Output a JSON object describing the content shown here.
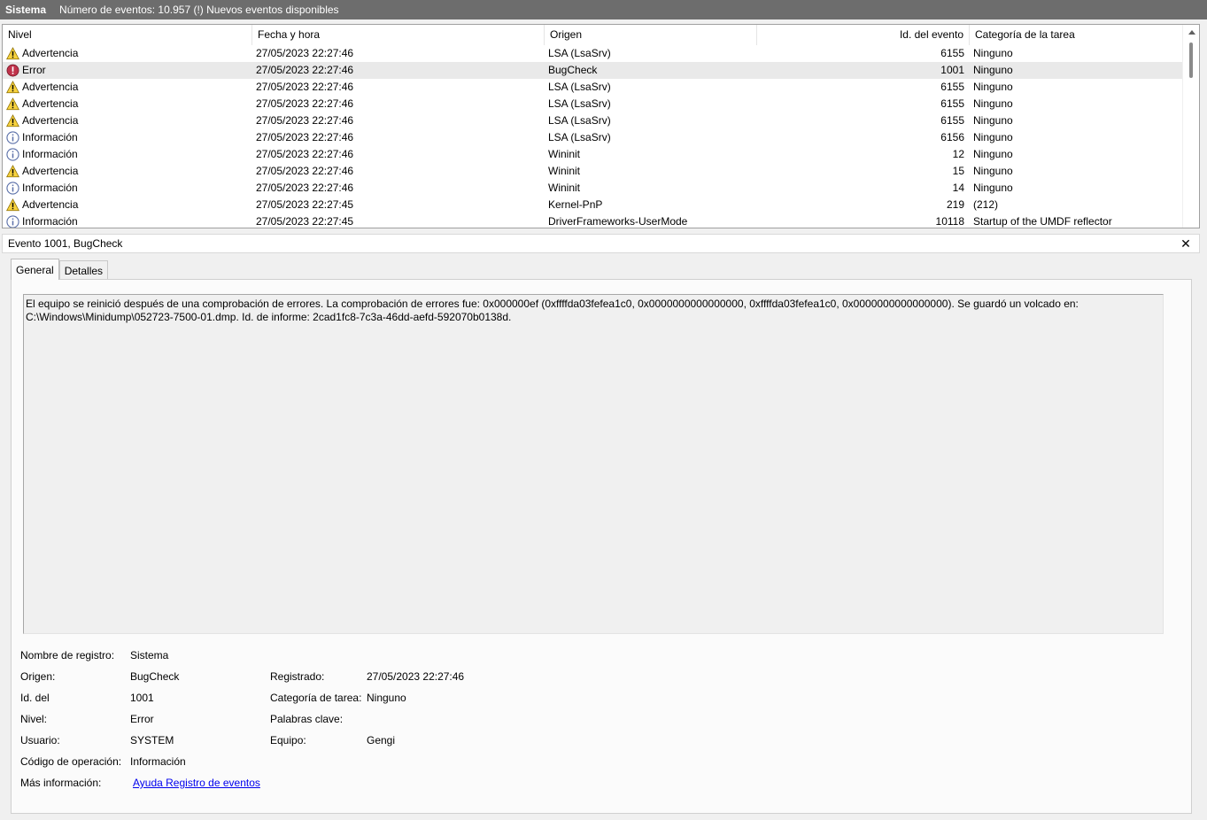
{
  "titlebar": {
    "title": "Sistema",
    "info": "Número de eventos: 10.957 (!) Nuevos eventos disponibles"
  },
  "list": {
    "columns": [
      "Nivel",
      "Fecha y hora",
      "Origen",
      "Id. del evento",
      "Categoría de la tarea"
    ],
    "rows": [
      {
        "icon": "warning-icon",
        "level": "Advertencia",
        "date": "27/05/2023 22:27:46",
        "source": "LSA (LsaSrv)",
        "id": "6155",
        "category": "Ninguno"
      },
      {
        "icon": "error-icon",
        "level": "Error",
        "date": "27/05/2023 22:27:46",
        "source": "BugCheck",
        "id": "1001",
        "category": "Ninguno",
        "selected": true
      },
      {
        "icon": "warning-icon",
        "level": "Advertencia",
        "date": "27/05/2023 22:27:46",
        "source": "LSA (LsaSrv)",
        "id": "6155",
        "category": "Ninguno"
      },
      {
        "icon": "warning-icon",
        "level": "Advertencia",
        "date": "27/05/2023 22:27:46",
        "source": "LSA (LsaSrv)",
        "id": "6155",
        "category": "Ninguno"
      },
      {
        "icon": "warning-icon",
        "level": "Advertencia",
        "date": "27/05/2023 22:27:46",
        "source": "LSA (LsaSrv)",
        "id": "6155",
        "category": "Ninguno"
      },
      {
        "icon": "info-icon",
        "level": "Información",
        "date": "27/05/2023 22:27:46",
        "source": "LSA (LsaSrv)",
        "id": "6156",
        "category": "Ninguno"
      },
      {
        "icon": "info-icon",
        "level": "Información",
        "date": "27/05/2023 22:27:46",
        "source": "Wininit",
        "id": "12",
        "category": "Ninguno"
      },
      {
        "icon": "warning-icon",
        "level": "Advertencia",
        "date": "27/05/2023 22:27:46",
        "source": "Wininit",
        "id": "15",
        "category": "Ninguno"
      },
      {
        "icon": "info-icon",
        "level": "Información",
        "date": "27/05/2023 22:27:46",
        "source": "Wininit",
        "id": "14",
        "category": "Ninguno"
      },
      {
        "icon": "warning-icon",
        "level": "Advertencia",
        "date": "27/05/2023 22:27:45",
        "source": "Kernel-PnP",
        "id": "219",
        "category": "(212)"
      },
      {
        "icon": "info-icon",
        "level": "Información",
        "date": "27/05/2023 22:27:45",
        "source": "DriverFrameworks-UserMode",
        "id": "10118",
        "category": "Startup of the UMDF reflector"
      }
    ]
  },
  "detail": {
    "header": "Evento 1001, BugCheck",
    "tabs": [
      "General",
      "Detalles"
    ],
    "description": "El equipo se reinició después de una comprobación de errores. La comprobación de errores fue: 0x000000ef (0xffffda03fefea1c0, 0x0000000000000000, 0xffffda03fefea1c0, 0x0000000000000000). Se guardó un volcado en: C:\\Windows\\Minidump\\052723-7500-01.dmp. Id. de informe: 2cad1fc8-7c3a-46dd-aefd-592070b0138d.",
    "props": {
      "log_name_label": "Nombre de registro:",
      "log_name": "Sistema",
      "source_label": "Origen:",
      "source": "BugCheck",
      "logged_label": "Registrado:",
      "logged": "27/05/2023 22:27:46",
      "event_id_label": "Id. del",
      "event_id": "1001",
      "task_cat_label": "Categoría de tarea:",
      "task_cat": "Ninguno",
      "level_label": "Nivel:",
      "level": "Error",
      "keywords_label": "Palabras clave:",
      "user_label": "Usuario:",
      "user": "SYSTEM",
      "computer_label": "Equipo:",
      "computer": "Gengi",
      "opcode_label": "Código de operación:",
      "opcode": "Información",
      "more_info_label": "Más información:",
      "more_info_link": "Ayuda Registro de eventos"
    }
  },
  "colors": {
    "titlebar": "#6d6d6d",
    "warning": "#f7d23e",
    "error": "#c0334b",
    "info": "#5a6fa8",
    "link": "#0000ee"
  }
}
